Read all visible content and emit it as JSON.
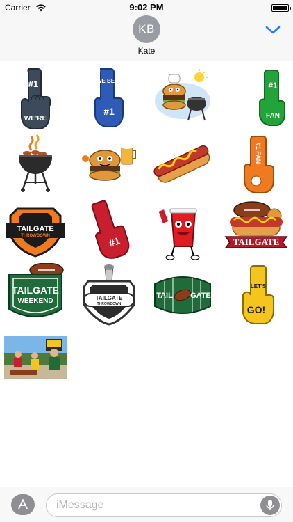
{
  "status_bar": {
    "carrier": "Carrier",
    "time": "9:02 PM"
  },
  "header": {
    "avatar_initials": "KB",
    "contact_name": "Kate"
  },
  "stickers": {
    "we_are_1": {
      "line1": "#1",
      "line2": "WE'RE"
    },
    "we_be_1": {
      "line1": "WE BE",
      "line2": "#1"
    },
    "fan_1": {
      "line1": "#1",
      "line2": "FAN"
    },
    "number_1_fan": {
      "text": "#1 FAN"
    },
    "tailgate_throwdown_1": {
      "title": "TAILGATE",
      "subtitle": "THROWDOWN"
    },
    "red_foam_hand": {
      "text": "#1"
    },
    "tailgate_hotdog": {
      "text": "TAILGATE"
    },
    "tailgate_weekend": {
      "title": "TAILGATE",
      "subtitle": "WEEKEND"
    },
    "tailgate_throwdown_2": {
      "title": "TAILGATE",
      "subtitle": "THROWDOWN"
    },
    "tail_gate_field": {
      "left": "TAIL",
      "right": "GATE"
    },
    "lets_go": {
      "line1": "LET'S",
      "line2": "GO!"
    }
  },
  "message_input": {
    "placeholder": "iMessage"
  },
  "colors": {
    "ios_blue": "#1f7ef5",
    "gray_button": "#8e8e93",
    "tailgate_green": "#1f6b3a",
    "tailgate_red": "#b11a28",
    "foam_blue": "#2d5bb5",
    "foam_green": "#22a43a",
    "foam_orange": "#f07a22",
    "foam_yellow": "#f3c51d",
    "foam_navy": "#3d4a5c"
  },
  "icons": {
    "wifi": "wifi-icon",
    "battery": "battery-icon",
    "chevron": "chevron-down-icon",
    "apps": "app-store-icon",
    "mic": "microphone-icon"
  }
}
